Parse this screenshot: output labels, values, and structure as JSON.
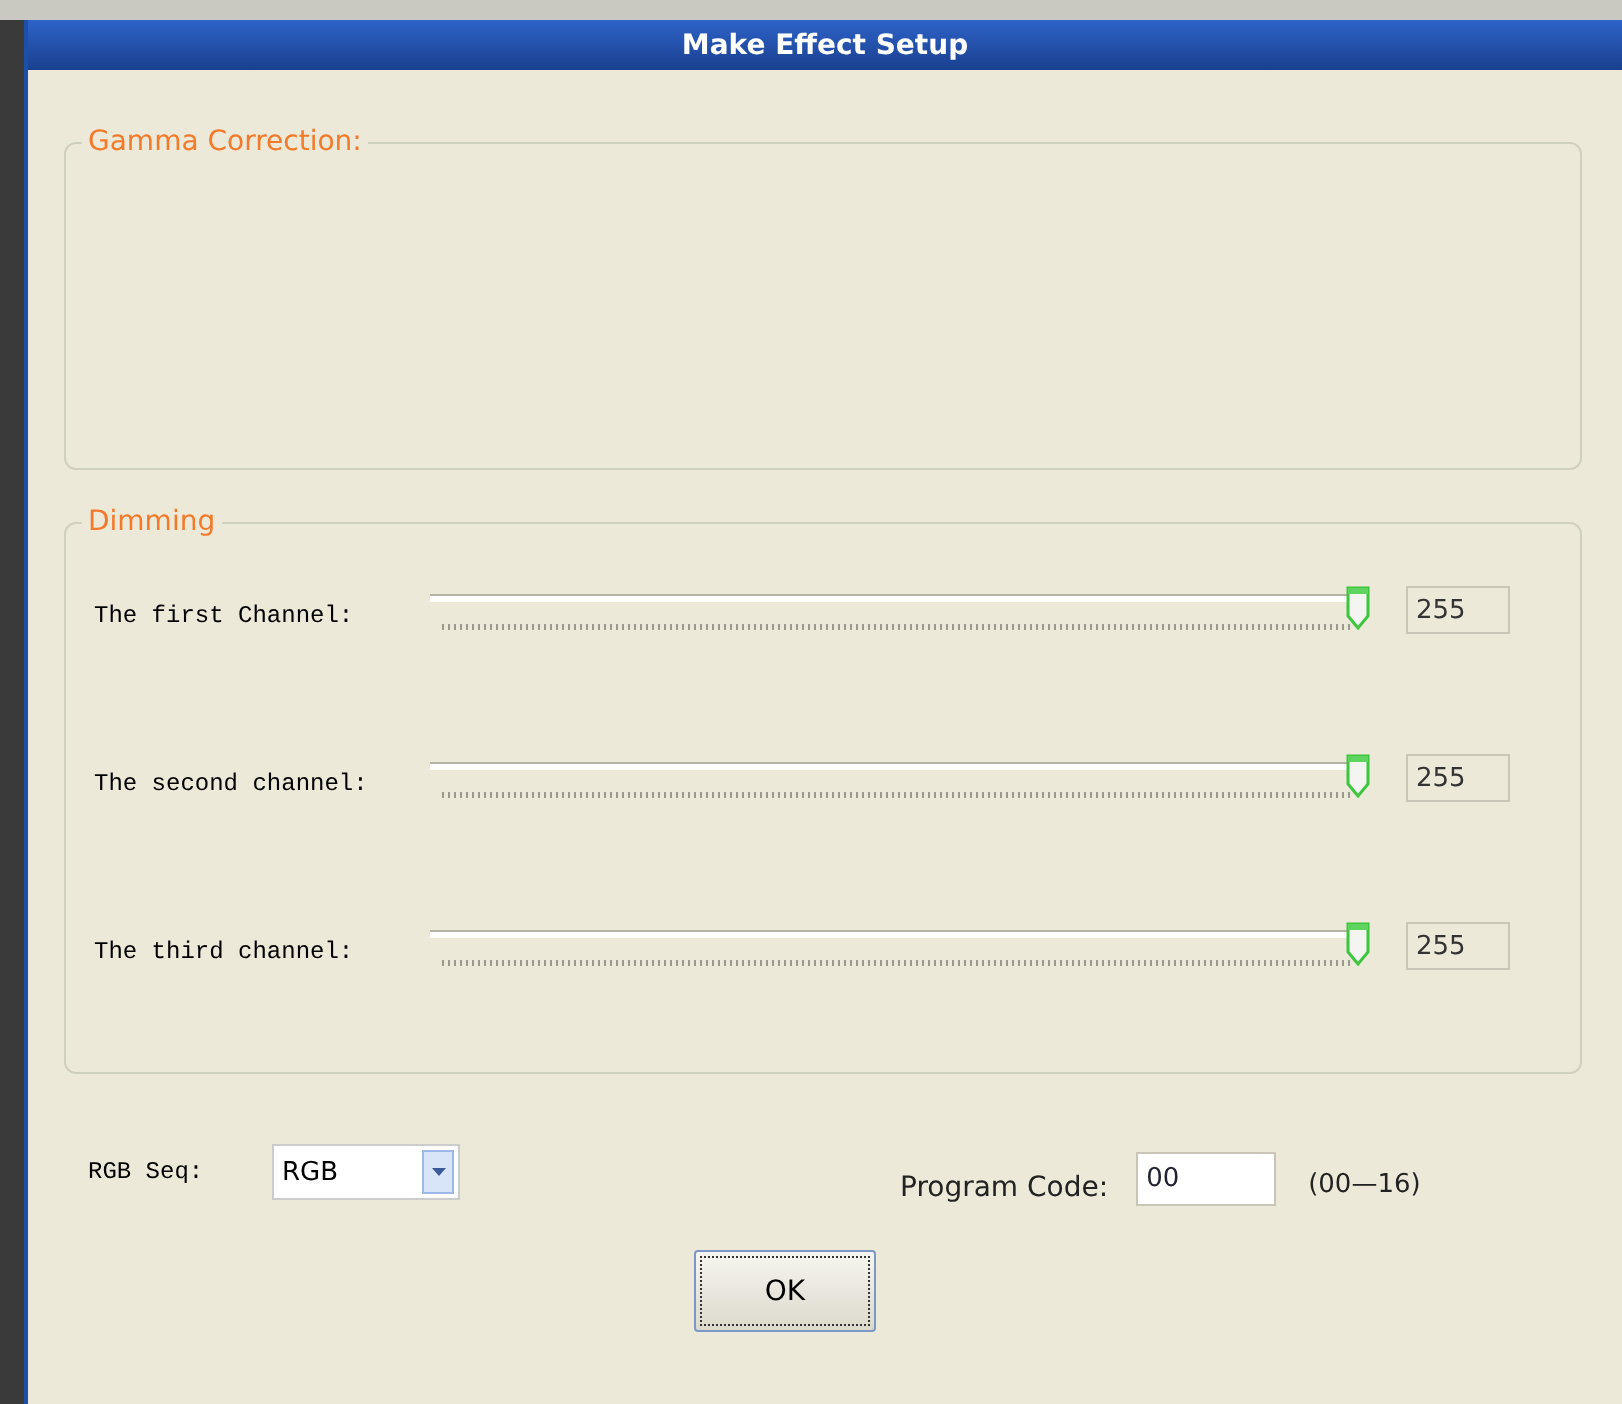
{
  "window": {
    "title": "Make Effect Setup"
  },
  "gamma": {
    "title": "Gamma Correction:"
  },
  "dimming": {
    "title": "Dimming",
    "channels": [
      {
        "label": "The first Channel:",
        "level": 1,
        "value": "255"
      },
      {
        "label": "The second channel:",
        "level": 1,
        "value": "255"
      },
      {
        "label": "The third channel:",
        "level": 1,
        "value": "255"
      }
    ]
  },
  "rgb_seq": {
    "label": "RGB Seq:",
    "value": "RGB"
  },
  "program_code": {
    "label": "Program Code:",
    "value": "00",
    "range": "(00—16)"
  },
  "buttons": [
    "OK"
  ]
}
